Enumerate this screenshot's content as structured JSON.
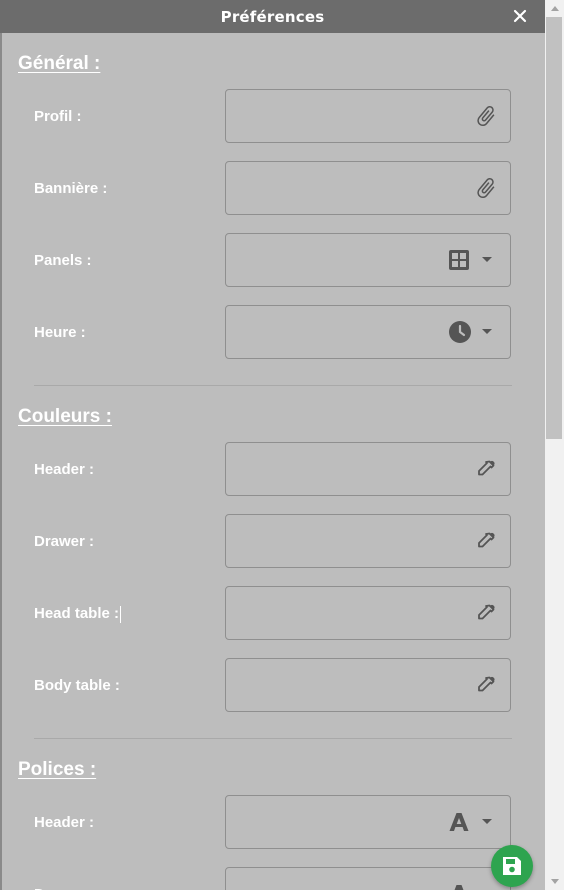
{
  "dialog": {
    "title": "Préférences"
  },
  "sections": {
    "general": {
      "title": "Général :",
      "rows": [
        {
          "label": "Profil :",
          "icon": "paperclip-icon"
        },
        {
          "label": "Bannière :",
          "icon": "paperclip-icon"
        },
        {
          "label": "Panels :",
          "icon": "grid-icon"
        },
        {
          "label": "Heure :",
          "icon": "clock-icon"
        }
      ]
    },
    "couleurs": {
      "title": "Couleurs :",
      "rows": [
        {
          "label": "Header :",
          "icon": "eyedropper-icon"
        },
        {
          "label": "Drawer :",
          "icon": "eyedropper-icon"
        },
        {
          "label": "Head table :",
          "icon": "eyedropper-icon"
        },
        {
          "label": "Body table :",
          "icon": "eyedropper-icon"
        }
      ]
    },
    "polices": {
      "title": "Polices :",
      "rows": [
        {
          "label": "Header :",
          "icon": "font-icon"
        },
        {
          "label": "D",
          "icon": "font-icon"
        }
      ]
    }
  },
  "colors": {
    "titlebar": "#6c6c6c",
    "panel": "#bdbdbd",
    "icon": "#555555",
    "save_button": "#2ea44f"
  }
}
